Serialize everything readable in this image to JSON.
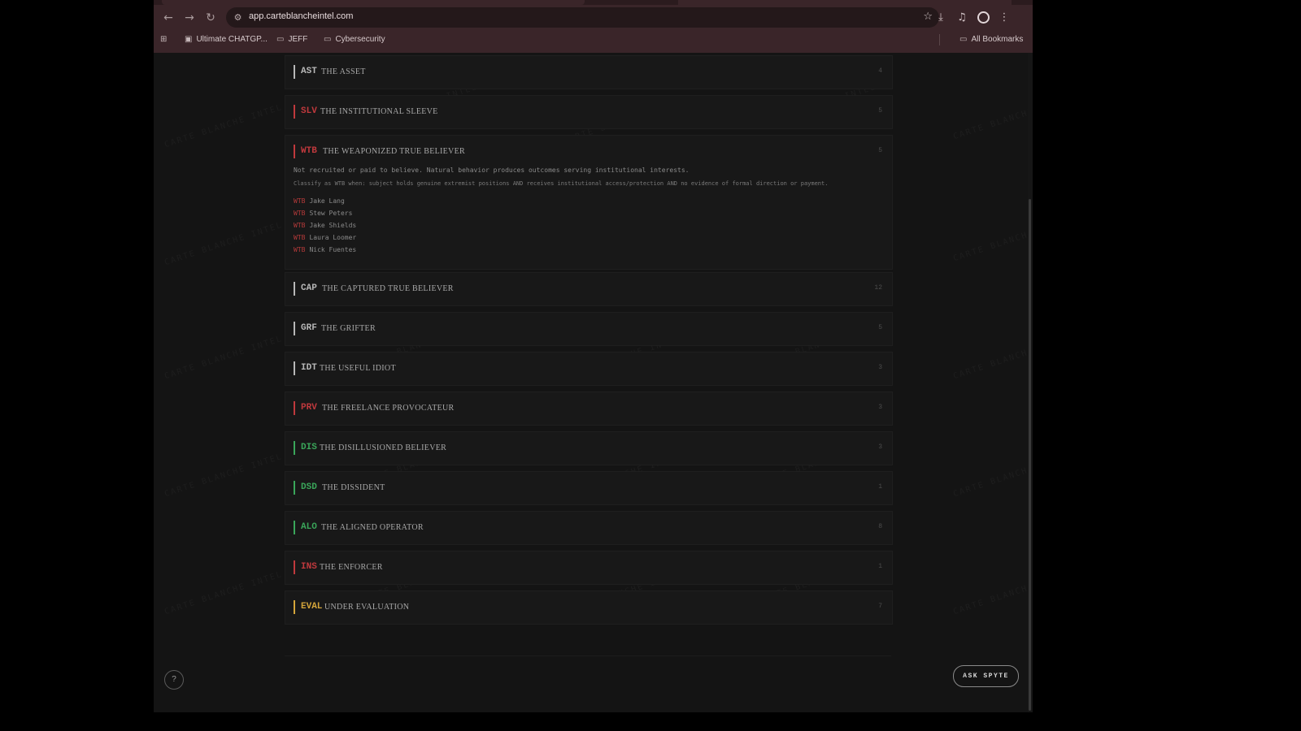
{
  "browser": {
    "url": "app.carteblancheintel.com",
    "bookmarks": [
      {
        "label": "Ultimate CHATGP..."
      },
      {
        "label": "JEFF"
      },
      {
        "label": "Cybersecurity"
      }
    ],
    "all_bookmarks": "All Bookmarks"
  },
  "categories": [
    {
      "code": "AST",
      "name": "THE ASSET",
      "count": "4",
      "color": "#b8b8b8"
    },
    {
      "code": "SLV",
      "name": "THE INSTITUTIONAL SLEEVE",
      "count": "5",
      "color": "#c0393d"
    },
    {
      "code": "WTB",
      "name": "THE WEAPONIZED TRUE BELIEVER",
      "count": "5",
      "color": "#c0393d",
      "description": "Not recruited or paid to believe. Natural behavior produces outcomes serving institutional interests.",
      "classify": "Classify as WTB when: subject holds genuine extremist positions AND receives institutional access/protection AND no evidence of formal direction or payment.",
      "members": [
        {
          "tag": "WTB",
          "name": "Jake Lang"
        },
        {
          "tag": "WTB",
          "name": "Stew Peters"
        },
        {
          "tag": "WTB",
          "name": "Jake Shields"
        },
        {
          "tag": "WTB",
          "name": "Laura Loomer"
        },
        {
          "tag": "WTB",
          "name": "Nick Fuentes"
        }
      ]
    },
    {
      "code": "CAP",
      "name": "THE CAPTURED TRUE BELIEVER",
      "count": "12",
      "color": "#b8b8b8"
    },
    {
      "code": "GRF",
      "name": "THE GRIFTER",
      "count": "5",
      "color": "#b8b8b8"
    },
    {
      "code": "IDT",
      "name": "THE USEFUL IDIOT",
      "count": "3",
      "color": "#b8b8b8"
    },
    {
      "code": "PRV",
      "name": "THE FREELANCE PROVOCATEUR",
      "count": "3",
      "color": "#c0393d"
    },
    {
      "code": "DIS",
      "name": "THE DISILLUSIONED BELIEVER",
      "count": "3",
      "color": "#3aa65a"
    },
    {
      "code": "DSD",
      "name": "THE DISSIDENT",
      "count": "1",
      "color": "#3aa65a"
    },
    {
      "code": "ALO",
      "name": "THE ALIGNED OPERATOR",
      "count": "8",
      "color": "#3aa65a"
    },
    {
      "code": "INS",
      "name": "THE ENFORCER",
      "count": "1",
      "color": "#c0393d"
    },
    {
      "code": "EVAL",
      "name": "UNDER EVALUATION",
      "count": "7",
      "color": "#d4a53a"
    }
  ],
  "help_label": "?",
  "ask_label": "ASK SPYTE"
}
